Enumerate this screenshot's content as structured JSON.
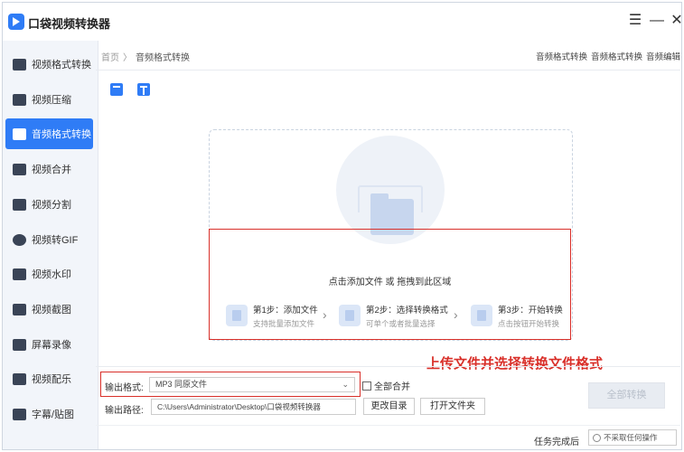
{
  "app": {
    "title": "口袋视频转换器"
  },
  "window_controls": {
    "menu": "☰",
    "minimize": "—",
    "close": "✕"
  },
  "sidebar": {
    "items": [
      {
        "label": "视频格式转换",
        "active": false
      },
      {
        "label": "视频压缩",
        "active": false
      },
      {
        "label": "音频格式转换",
        "active": true
      },
      {
        "label": "视频合并",
        "active": false
      },
      {
        "label": "视频分割",
        "active": false
      },
      {
        "label": "视频转GIF",
        "active": false
      },
      {
        "label": "视频水印",
        "active": false
      },
      {
        "label": "视频截图",
        "active": false
      },
      {
        "label": "屏幕录像",
        "active": false
      },
      {
        "label": "视频配乐",
        "active": false
      },
      {
        "label": "字幕/贴图",
        "active": false
      }
    ]
  },
  "breadcrumb": {
    "home": "首页",
    "separator": "〉",
    "current": "音频格式转换"
  },
  "top_links": [
    "音频格式转换",
    "音频格式转换",
    "音频编辑"
  ],
  "drop_area": {
    "hint": "点击添加文件 或 拖拽到此区域",
    "steps": [
      {
        "title": "第1步：添加文件",
        "desc": "支持批量添加文件"
      },
      {
        "title": "第2步：选择转换格式",
        "desc": "可单个或者批量选择"
      },
      {
        "title": "第3步：开始转换",
        "desc": "点击按钮开始转换"
      }
    ],
    "arrow": "›"
  },
  "annotation": "上传文件并选择转换文件格式",
  "output": {
    "format_label": "输出格式:",
    "format_value": "MP3  同原文件",
    "merge_label": "全部合并",
    "path_label": "输出路径:",
    "path_value": "C:\\Users\\Administrator\\Desktop\\口袋视频转换器",
    "change_dir": "更改目录",
    "open_folder": "打开文件夹",
    "convert_all": "全部转换"
  },
  "status": {
    "label": "任务完成后",
    "option": "不采取任何操作"
  },
  "colors": {
    "accent": "#2f7cf6",
    "annotation_red": "#d9302a"
  }
}
